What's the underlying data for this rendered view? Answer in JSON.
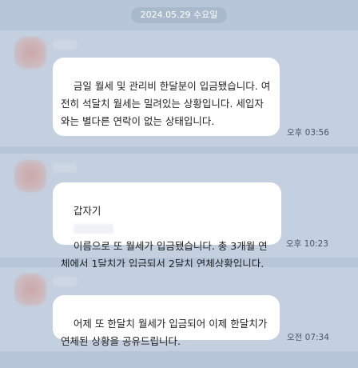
{
  "date_separator": "2024.05.29 수요일",
  "messages": [
    {
      "text": "금일 월세 및 관리비 한달분이 입금됐습니다. 여전히 석달치 월세는 밀려있는 상황입니다. 세입자와는 별다른 연락이 없는 상태입니다.",
      "time": "오후 03:56"
    },
    {
      "text_before": "갑자기",
      "text_after": "이름으로 또 월세가 입금됐습니다. 총 3개월 연체에서 1달치가 입금되서 2달치 연체상황입니다.",
      "time": "오후 10:23"
    },
    {
      "text": "어제 또 한달치 월세가 입금되어 이제 한달치가 연체된 상황을 공유드립니다.",
      "time": "오전 07:34"
    }
  ],
  "icons": {
    "avatar": "blurred-profile-avatar"
  }
}
